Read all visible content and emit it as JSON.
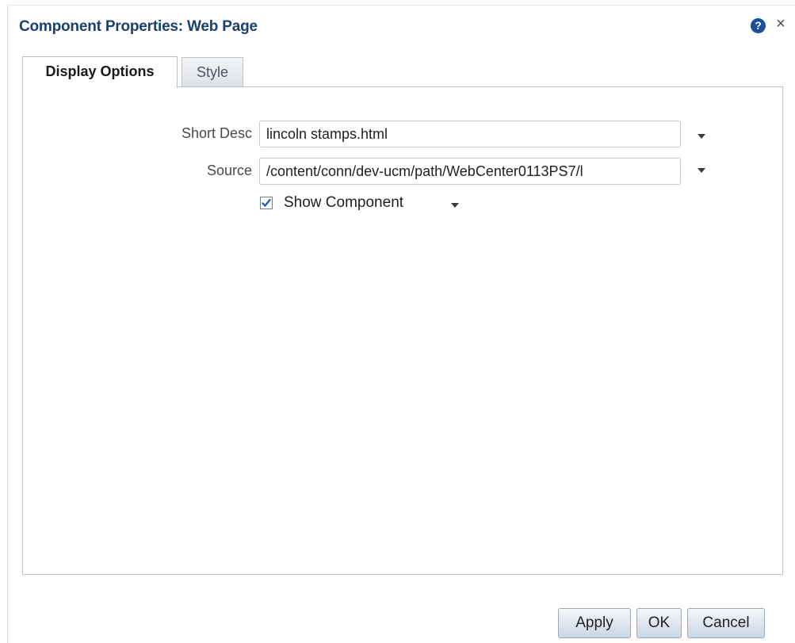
{
  "dialog": {
    "title": "Component Properties: Web Page",
    "help_icon": "question-circle-icon",
    "help_glyph": "?",
    "close_icon": "close-icon",
    "close_glyph": "×"
  },
  "tabs": [
    {
      "label": "Display Options",
      "active": true
    },
    {
      "label": "Style",
      "active": false
    }
  ],
  "form": {
    "short_desc": {
      "label": "Short Desc",
      "value": "lincoln stamps.html"
    },
    "source": {
      "label": "Source",
      "value": "/content/conn/dev-ucm/path/WebCenter0113PS7/l"
    },
    "show_component": {
      "label": "Show Component",
      "checked": true
    }
  },
  "buttons": {
    "apply": "Apply",
    "ok": "OK",
    "cancel": "Cancel"
  },
  "colors": {
    "title": "#1b3f6e",
    "help_icon": "#1a4f9c",
    "checkbox_check": "#2b5cb0"
  }
}
